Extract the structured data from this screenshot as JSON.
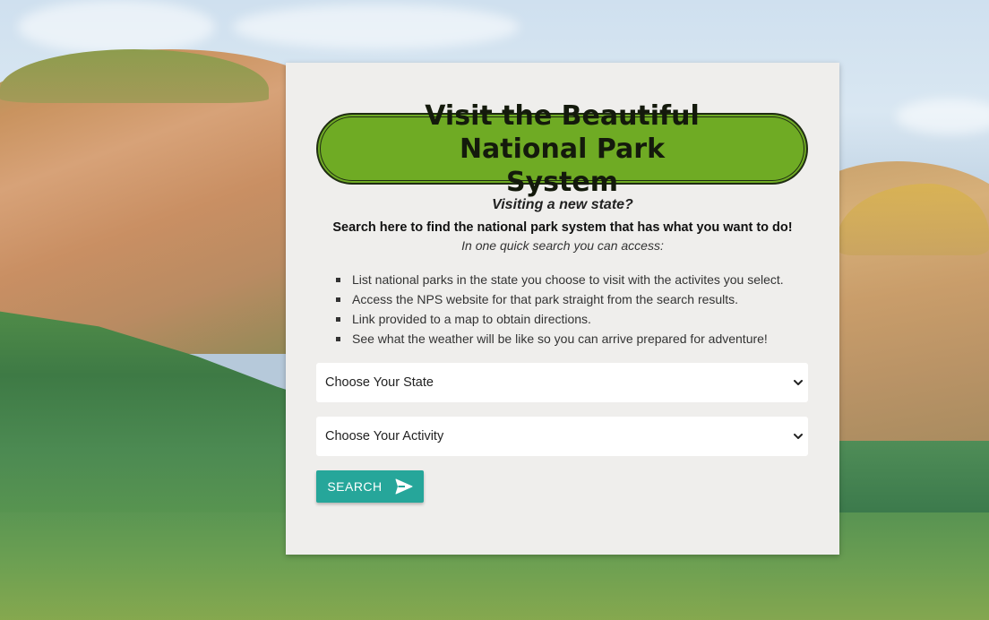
{
  "card": {
    "title": "Visit the Beautiful National Park System",
    "subhead": "Visiting a new state?",
    "lead": "Search here to find the national park system that has what you want to do!",
    "note": "In one quick search you can access:",
    "features": [
      "List national parks in the state you choose to visit with the activites you select.",
      "Access the NPS website for that park straight from the search results.",
      "Link provided to a map to obtain directions.",
      "See what the weather will be like so you can arrive prepared for adventure!"
    ]
  },
  "form": {
    "state_select": {
      "selected": "Choose Your State"
    },
    "activity_select": {
      "selected": "Choose Your Activity"
    },
    "search_button": {
      "label": "SEARCH",
      "icon": "send-icon"
    }
  },
  "colors": {
    "title_pill": "#6fab24",
    "card_bg": "#efeeec",
    "button": "#26a69a"
  }
}
